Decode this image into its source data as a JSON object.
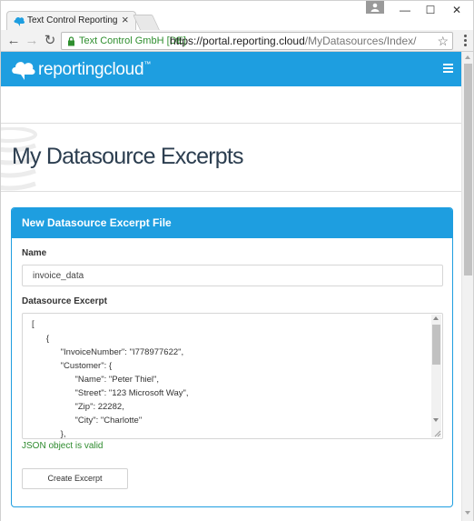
{
  "browser": {
    "tab_title": "Text Control ReportingCl",
    "tab_close": "×",
    "window_controls": {
      "minimize": "—",
      "maximize": "☐",
      "close": "✕"
    },
    "nav": {
      "back": "←",
      "forward": "→",
      "reload": "↻"
    },
    "ev_badge": "Text Control GmbH [DE]",
    "url_host": "https://portal.reporting.cloud",
    "url_path": "/MyDatasources/Index/",
    "bookmark_star": "☆"
  },
  "navbar": {
    "brand": "reportingcloud",
    "brand_tm": "™",
    "brand_color": "#1e9ee0"
  },
  "page": {
    "title": "My Datasource Excerpts"
  },
  "panel": {
    "heading": "New Datasource Excerpt File",
    "name_label": "Name",
    "name_value": "invoice_data",
    "excerpt_label": "Datasource Excerpt",
    "excerpt_lines": [
      "[",
      "      {",
      "            \"InvoiceNumber\": \"I778977622\",",
      "            \"Customer\": {",
      "                  \"Name\": \"Peter Thiel\",",
      "                  \"Street\": \"123 Microsoft Way\",",
      "                  \"Zip\": 22282,",
      "                  \"City\": \"Charlotte\"",
      "            },"
    ],
    "validation_message": "JSON object is valid",
    "validation_color": "#2e8b2e",
    "create_button": "Create Excerpt"
  }
}
